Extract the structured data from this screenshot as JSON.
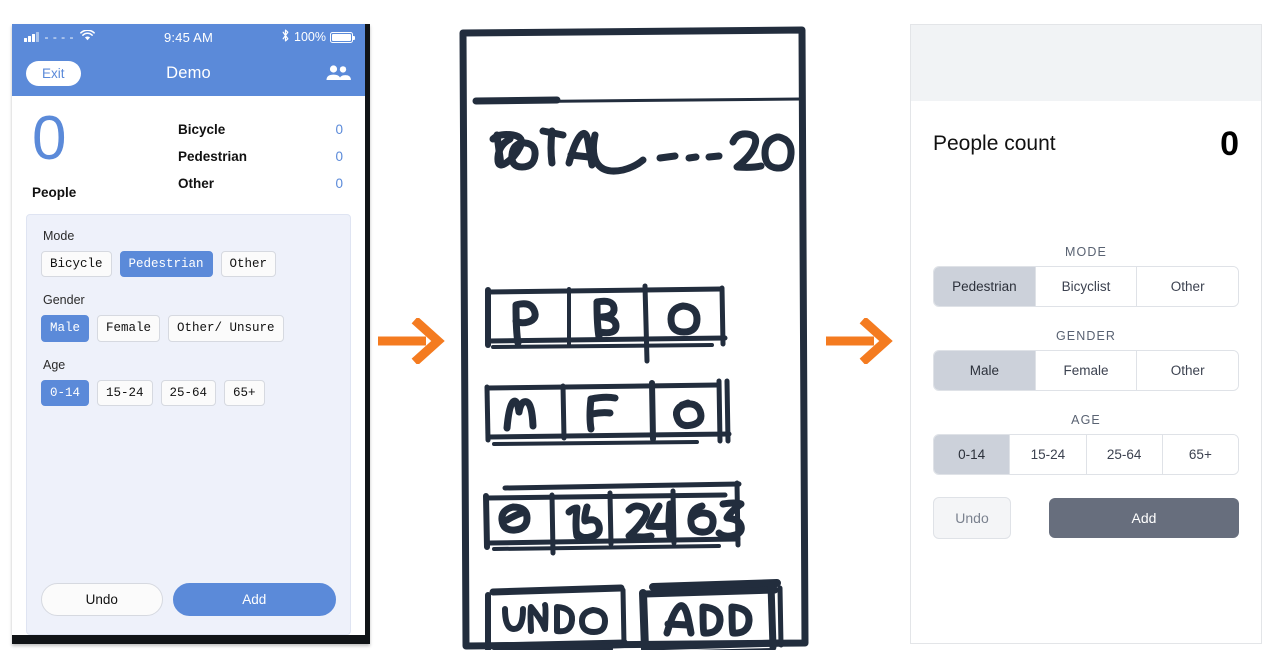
{
  "panel_lofi": {
    "name": "iOS prototype screen",
    "status_bar": {
      "carrier": "- - - -",
      "time": "9:45 AM",
      "battery_text": "100%",
      "signal_icon": "signal-bars-icon",
      "wifi_icon": "wifi-icon",
      "bluetooth_icon": "bluetooth-icon",
      "battery_icon": "battery-full-icon"
    },
    "nav": {
      "exit_label": "Exit",
      "title": "Demo",
      "people_icon": "people-icon"
    },
    "summary": {
      "count": "0",
      "count_label": "People",
      "breakdown": [
        {
          "label": "Bicycle",
          "value": "0"
        },
        {
          "label": "Pedestrian",
          "value": "0"
        },
        {
          "label": "Other",
          "value": "0"
        }
      ]
    },
    "groups": [
      {
        "label": "Mode",
        "options": [
          {
            "label": "Bicycle",
            "selected": false
          },
          {
            "label": "Pedestrian",
            "selected": true
          },
          {
            "label": "Other",
            "selected": false
          }
        ]
      },
      {
        "label": "Gender",
        "options": [
          {
            "label": "Male",
            "selected": true
          },
          {
            "label": "Female",
            "selected": false
          },
          {
            "label": "Other/ Unsure",
            "selected": false
          }
        ]
      },
      {
        "label": "Age",
        "options": [
          {
            "label": "0-14",
            "selected": true
          },
          {
            "label": "15-24",
            "selected": false
          },
          {
            "label": "25-64",
            "selected": false
          },
          {
            "label": "65+",
            "selected": false
          }
        ]
      }
    ],
    "actions": {
      "undo_label": "Undo",
      "add_label": "Add"
    }
  },
  "panel_sketch": {
    "name": "hand-drawn wireframe",
    "header_text": "TOTAL - - - 20",
    "rows": [
      {
        "name": "mode-row",
        "cells": [
          "P",
          "B",
          "O"
        ]
      },
      {
        "name": "gender-row",
        "cells": [
          "M",
          "F",
          "O"
        ]
      },
      {
        "name": "age-row",
        "cells": [
          "0",
          "15",
          "24",
          "65"
        ]
      }
    ],
    "buttons": [
      {
        "name": "undo-button",
        "label": "UNDO"
      },
      {
        "name": "add-button",
        "label": "ADD"
      }
    ]
  },
  "panel_hifi": {
    "name": "high fidelity mockup",
    "title": "People count",
    "count": "0",
    "groups": [
      {
        "label": "MODE",
        "options": [
          {
            "label": "Pedestrian",
            "selected": true
          },
          {
            "label": "Bicyclist",
            "selected": false
          },
          {
            "label": "Other",
            "selected": false
          }
        ]
      },
      {
        "label": "GENDER",
        "options": [
          {
            "label": "Male",
            "selected": true
          },
          {
            "label": "Female",
            "selected": false
          },
          {
            "label": "Other",
            "selected": false
          }
        ]
      },
      {
        "label": "AGE",
        "options": [
          {
            "label": "0-14",
            "selected": true
          },
          {
            "label": "15-24",
            "selected": false
          },
          {
            "label": "25-64",
            "selected": false
          },
          {
            "label": "65+",
            "selected": false
          }
        ]
      }
    ],
    "actions": {
      "undo_label": "Undo",
      "add_label": "Add"
    }
  },
  "arrows": [
    {
      "name": "arrow-lofi-to-sketch",
      "icon": "arrow-right-icon"
    },
    {
      "name": "arrow-sketch-to-hifi",
      "icon": "arrow-right-icon"
    }
  ],
  "colors": {
    "ios_blue": "#5b8ad9",
    "arrow_orange": "#F47B20",
    "sketch_ink": "#222d3d",
    "hifi_selected": "#ccd1da",
    "hifi_add": "#676e7d"
  }
}
